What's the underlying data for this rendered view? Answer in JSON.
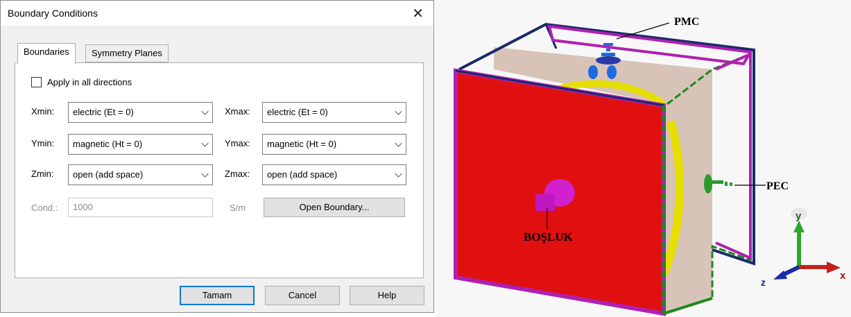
{
  "dialog": {
    "title": "Boundary Conditions",
    "tabs": [
      {
        "label": "Boundaries",
        "active": true
      },
      {
        "label": "Symmetry Planes",
        "active": false
      }
    ],
    "apply_all_label": "Apply in all directions",
    "apply_all_checked": false,
    "rows": [
      {
        "min_label": "Xmin:",
        "min_value": "electric (Et = 0)",
        "max_label": "Xmax:",
        "max_value": "electric (Et = 0)"
      },
      {
        "min_label": "Ymin:",
        "min_value": "magnetic (Ht = 0)",
        "max_label": "Ymax:",
        "max_value": "magnetic (Ht = 0)"
      },
      {
        "min_label": "Zmin:",
        "min_value": "open (add space)",
        "max_label": "Zmax:",
        "max_value": "open (add space)"
      }
    ],
    "cond": {
      "label": "Cond.:",
      "value": "1000",
      "unit": "S/m"
    },
    "open_boundary_button": "Open Boundary...",
    "buttons": {
      "ok": "Tamam",
      "cancel": "Cancel",
      "help": "Help"
    }
  },
  "model": {
    "labels": {
      "pmc": "PMC",
      "pec": "PEC",
      "void": "BOŞLUK"
    },
    "axes": {
      "x": "x",
      "y": "y",
      "z": "z"
    },
    "colors": {
      "front_face": "#e01010",
      "pmc_frame": "#b020b0",
      "pec_frame": "#1a8a1a",
      "edges": "#1a2a6a",
      "ring": "#e6e000",
      "back_panel": "#d8c3b8"
    }
  }
}
